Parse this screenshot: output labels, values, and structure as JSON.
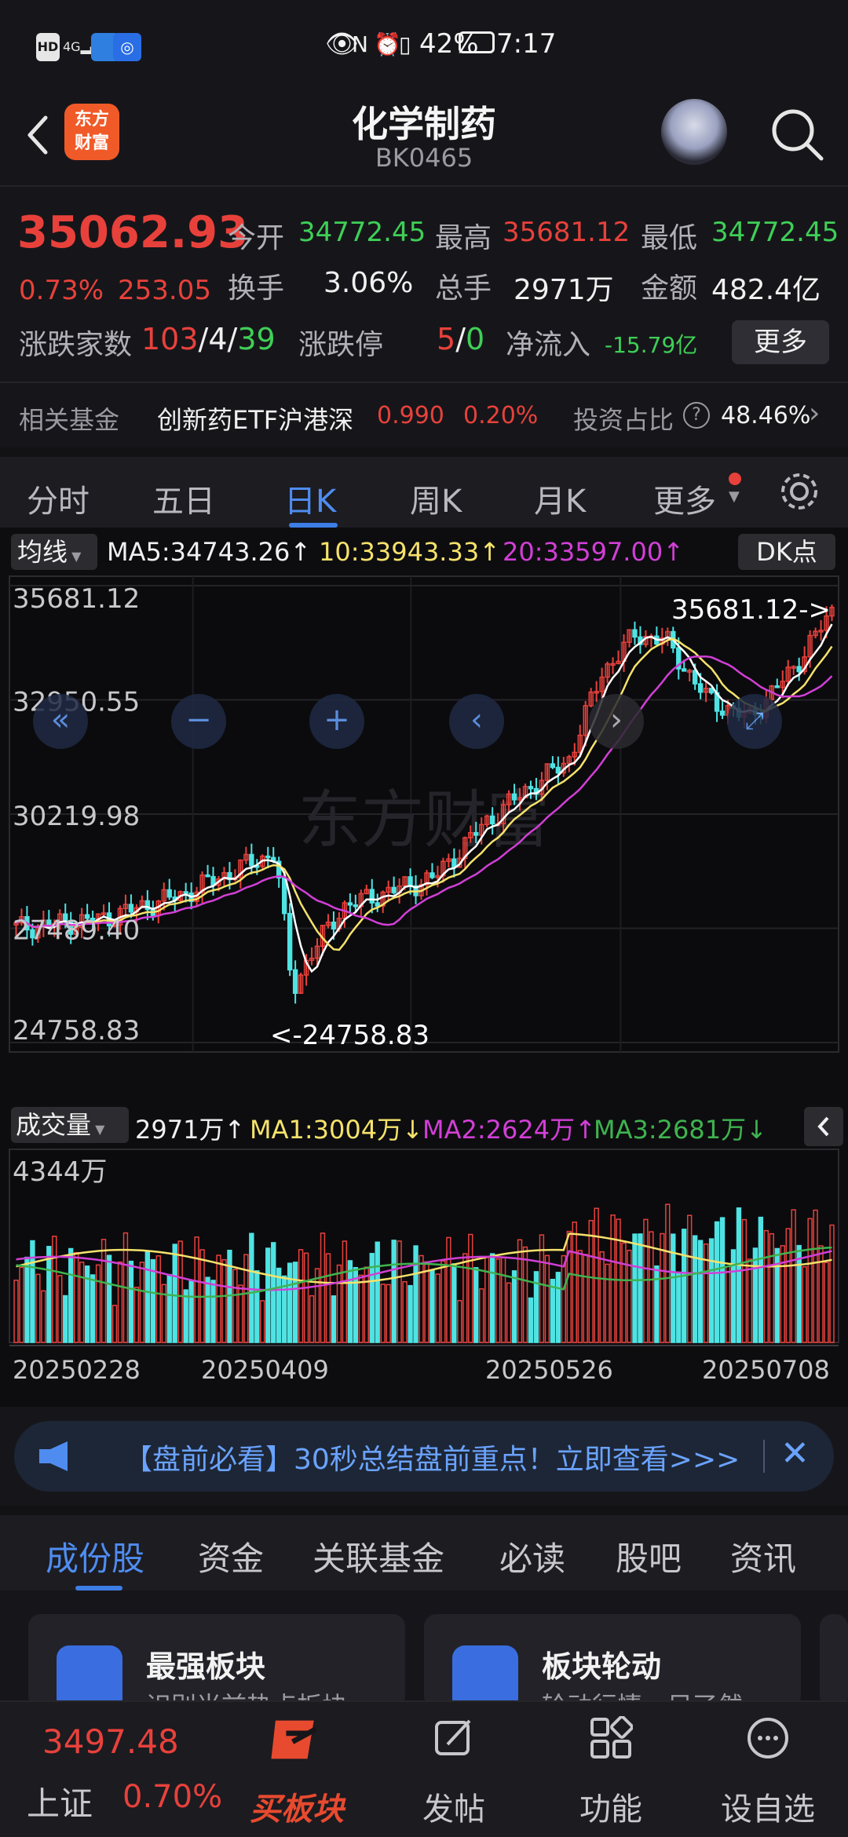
{
  "status_bar": {
    "left_icons": [
      "hd-icon",
      "4g-signal-icon",
      "weather-app-icon",
      "bulb-app-icon"
    ],
    "battery_pct": "42%",
    "time": "7:17"
  },
  "header": {
    "logo_line1": "东方",
    "logo_line2": "财富",
    "title": "化学制药",
    "code": "BK0465"
  },
  "quote": {
    "price": "35062.93",
    "change_pct": "0.73%",
    "change_abs": "253.05",
    "open_label": "今开",
    "open": "34772.45",
    "high_label": "最高",
    "high": "35681.12",
    "low_label": "最低",
    "low": "34772.45",
    "turnover_label": "换手",
    "turnover": "3.06%",
    "volume_label": "总手",
    "volume": "2971万",
    "amount_label": "金额",
    "amount": "482.4亿",
    "adv_label": "涨跌家数",
    "adv_up": "103",
    "adv_flat": "4",
    "adv_down": "39",
    "limit_label": "涨跌停",
    "limit_up": "5",
    "limit_down": "0",
    "inflow_label": "净流入",
    "inflow": "-15.79亿",
    "more": "更多"
  },
  "fund": {
    "label": "相关基金",
    "name": "创新药ETF沪港深",
    "price": "0.990",
    "change": "0.20%",
    "ratio_label": "投资占比",
    "ratio": "48.46%"
  },
  "ktabs": [
    "分时",
    "五日",
    "日K",
    "周K",
    "月K",
    "更多"
  ],
  "ma_bar": {
    "btn": "均线",
    "ma5": "MA5:34743.26↑",
    "ma10": "10:33943.33↑",
    "ma20": "20:33597.00↑",
    "dk": "DK点"
  },
  "vol_bar": {
    "btn": "成交量",
    "vol": "2971万↑",
    "ma1": "MA1:3004万↓",
    "ma2": "MA2:2624万↑",
    "ma3": "MA3:2681万↓"
  },
  "chart_data": {
    "type": "candlestick",
    "y_ticks": [
      "35681.12",
      "32950.55",
      "30219.98",
      "27489.40",
      "24758.83"
    ],
    "ylim": [
      24758.83,
      35681.12
    ],
    "max_label": "35681.12->",
    "min_label": "<-24758.83",
    "watermark": "东方财富",
    "vol_max_label": "4344万",
    "x_ticks": [
      "20250228",
      "20250409",
      "20250526",
      "20250708"
    ],
    "colors": {
      "up": "#e8413b",
      "down": "#4fe3e3",
      "ma5": "#ffffff",
      "ma10": "#f5e26b",
      "ma20": "#d23fd6",
      "vol_ma3": "#3fb34f"
    }
  },
  "banner": {
    "text": "【盘前必看】30秒总结盘前重点！立即查看>>>"
  },
  "btabs": [
    "成份股",
    "资金",
    "关联基金",
    "必读",
    "股吧",
    "资讯"
  ],
  "cards": [
    {
      "title": "最强板块",
      "sub": "识别当前热点板块"
    },
    {
      "title": "板块轮动",
      "sub": "轮动行情一目了然"
    }
  ],
  "nav": {
    "index_value": "3497.48",
    "index_name": "上证",
    "index_change": "0.70%",
    "items": [
      "买板块",
      "发帖",
      "功能",
      "设自选"
    ]
  }
}
